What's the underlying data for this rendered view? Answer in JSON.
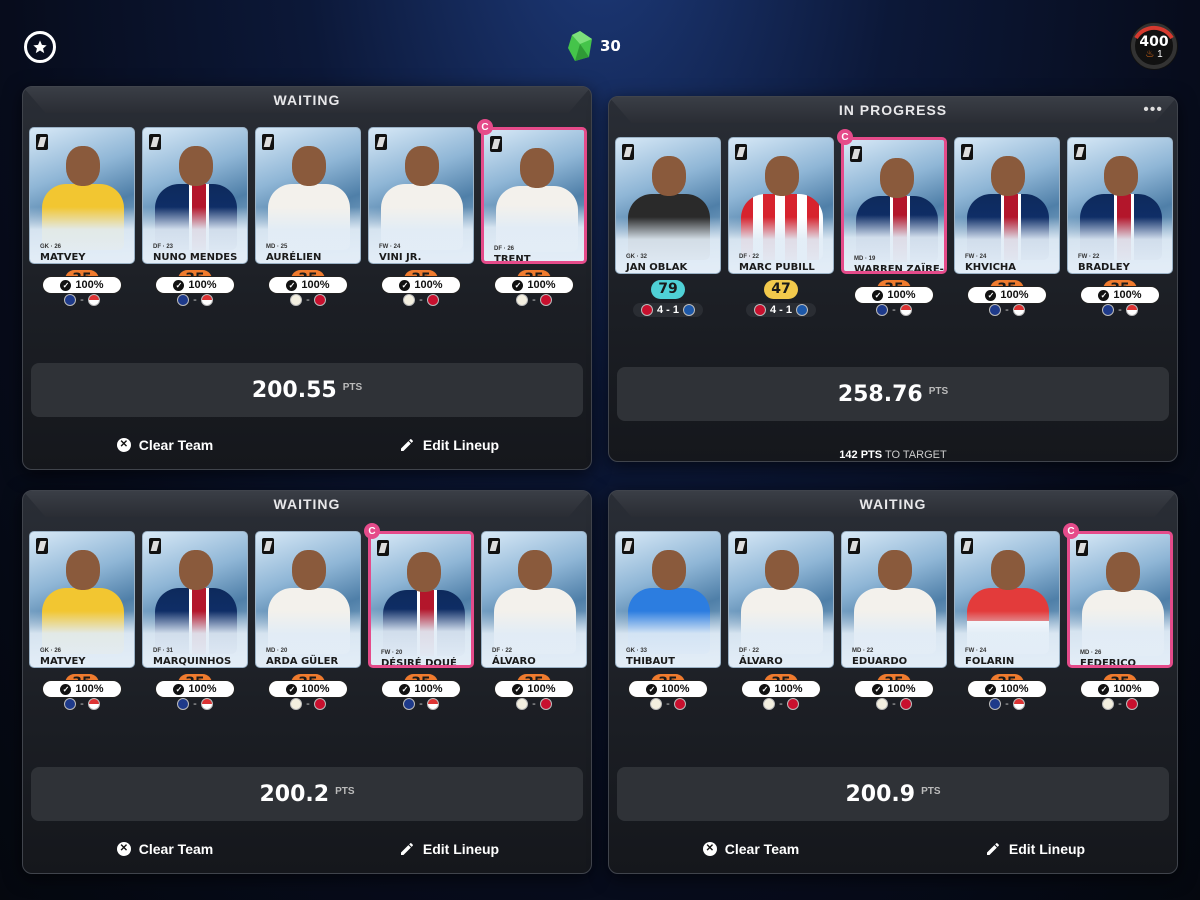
{
  "header": {
    "gems": "30",
    "level": "400",
    "streak": "1",
    "colors": {
      "gem": "#45c44a",
      "xp_ring": "#d63a2f"
    }
  },
  "common": {
    "clear_label": "Clear Team",
    "edit_label": "Edit Lineup",
    "pts_unit": "PTS",
    "captain_mark": "C"
  },
  "panels": [
    {
      "status": "WAITING",
      "points": "200.55",
      "players": [
        {
          "name": "MATVEY SAFONOV",
          "meta": "GK · 26",
          "pct": "100%",
          "score": "35",
          "kit": "gk-yellow",
          "fixture": [
            "psg",
            "mon"
          ],
          "captain": false
        },
        {
          "name": "NUNO MENDES",
          "meta": "DF · 23",
          "pct": "100%",
          "score": "35",
          "kit": "psg",
          "fixture": [
            "psg",
            "mon"
          ],
          "captain": false
        },
        {
          "name": "AURÉLIEN TCHOUAMÉNI",
          "meta": "MD · 25",
          "pct": "100%",
          "score": "35",
          "kit": "rma",
          "fixture": [
            "rma",
            "ben"
          ],
          "captain": false
        },
        {
          "name": "VINI JR.",
          "meta": "FW · 24",
          "pct": "100%",
          "score": "35",
          "kit": "rma",
          "fixture": [
            "rma",
            "ben"
          ],
          "captain": false
        },
        {
          "name": "TRENT ALEXANDER-ARNOLD",
          "meta": "DF · 26",
          "pct": "100%",
          "score": "35",
          "kit": "rma",
          "fixture": [
            "rma",
            "ben"
          ],
          "captain": true
        }
      ]
    },
    {
      "status": "IN PROGRESS",
      "points": "258.76",
      "target_value": "142 PTS",
      "target_suffix": "TO TARGET",
      "players": [
        {
          "name": "JAN OBLAK",
          "meta": "GK · 32",
          "pct": "",
          "score": "79",
          "score_color": "teal",
          "kit": "atm-gk",
          "live": "4 - 1",
          "captain": false,
          "mascot": true
        },
        {
          "name": "MARC PUBILL",
          "meta": "DF · 22",
          "pct": "",
          "score": "47",
          "score_color": "yellow",
          "kit": "atm",
          "live": "4 - 1",
          "captain": false
        },
        {
          "name": "WARREN ZAÏRE-EMERY",
          "meta": "MD · 19",
          "pct": "100%",
          "score": "35",
          "kit": "psg",
          "fixture": [
            "psg",
            "mon"
          ],
          "captain": true
        },
        {
          "name": "KHVICHA KVARATSKHELIA",
          "meta": "FW · 24",
          "pct": "100%",
          "score": "35",
          "kit": "psg",
          "fixture": [
            "psg",
            "mon"
          ],
          "captain": false
        },
        {
          "name": "BRADLEY BARCOLA",
          "meta": "FW · 22",
          "pct": "100%",
          "score": "35",
          "kit": "psg",
          "fixture": [
            "psg",
            "mon"
          ],
          "captain": false
        }
      ]
    },
    {
      "status": "WAITING",
      "points": "200.2",
      "players": [
        {
          "name": "MATVEY SAFONOV",
          "meta": "GK · 26",
          "pct": "100%",
          "score": "35",
          "kit": "gk-yellow",
          "fixture": [
            "psg",
            "mon"
          ],
          "captain": false
        },
        {
          "name": "MARQUINHOS",
          "meta": "DF · 31",
          "pct": "100%",
          "score": "35",
          "kit": "psg",
          "fixture": [
            "psg",
            "mon"
          ],
          "captain": false
        },
        {
          "name": "ARDA GÜLER",
          "meta": "MD · 20",
          "pct": "100%",
          "score": "35",
          "kit": "rma",
          "fixture": [
            "rma",
            "ben"
          ],
          "captain": false
        },
        {
          "name": "DÉSIRÉ DOUÉ",
          "meta": "FW · 20",
          "pct": "100%",
          "score": "35",
          "kit": "psg",
          "fixture": [
            "psg",
            "mon"
          ],
          "captain": true
        },
        {
          "name": "ÁLVARO CARRERAS",
          "meta": "DF · 22",
          "pct": "100%",
          "score": "35",
          "kit": "rma",
          "fixture": [
            "rma",
            "ben"
          ],
          "captain": false
        }
      ]
    },
    {
      "status": "WAITING",
      "points": "200.9",
      "players": [
        {
          "name": "THIBAUT COURTOIS",
          "meta": "GK · 33",
          "pct": "100%",
          "score": "35",
          "kit": "rma-blue",
          "fixture": [
            "rma",
            "ben"
          ],
          "captain": false
        },
        {
          "name": "ÁLVARO CARRERAS",
          "meta": "DF · 22",
          "pct": "100%",
          "score": "35",
          "kit": "rma",
          "fixture": [
            "rma",
            "ben"
          ],
          "captain": false
        },
        {
          "name": "EDUARDO CAMAVINGA",
          "meta": "MD · 22",
          "pct": "100%",
          "score": "35",
          "kit": "rma",
          "fixture": [
            "rma",
            "ben"
          ],
          "captain": false
        },
        {
          "name": "FOLARIN BALOGUN",
          "meta": "FW · 24",
          "pct": "100%",
          "score": "35",
          "kit": "monaco",
          "fixture": [
            "psg",
            "mon"
          ],
          "captain": false
        },
        {
          "name": "FEDERICO VALVERDE",
          "meta": "MD · 26",
          "pct": "100%",
          "score": "35",
          "kit": "rma",
          "fixture": [
            "rma",
            "ben"
          ],
          "captain": true
        }
      ]
    }
  ]
}
